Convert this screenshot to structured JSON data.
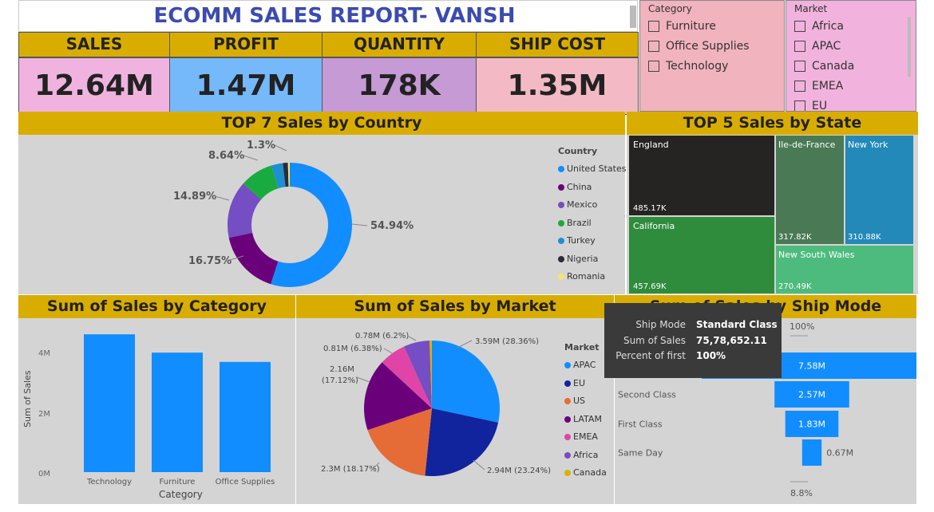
{
  "report": {
    "title": "ECOMM SALES REPORT- VANSH"
  },
  "kpis": [
    {
      "label": "SALES",
      "value": "12.64M",
      "bg": "#f0b3df"
    },
    {
      "label": "PROFIT",
      "value": "1.47M",
      "bg": "#75b9fa"
    },
    {
      "label": "QUANTITY",
      "value": "178K",
      "bg": "#c59ad5"
    },
    {
      "label": "SHIP COST",
      "value": "1.35M",
      "bg": "#f3b9c4"
    }
  ],
  "category_slicer": {
    "title": "Category",
    "items": [
      "Furniture",
      "Office Supplies",
      "Technology"
    ]
  },
  "market_slicer": {
    "title": "Market",
    "items": [
      "Africa",
      "APAC",
      "Canada",
      "EMEA",
      "EU"
    ]
  },
  "country_chart": {
    "title": "TOP 7 Sales by Country",
    "legend_title": "Country",
    "labels": {
      "us": "54.94%",
      "china": "16.75%",
      "mexico": "14.89%",
      "brazil": "8.64%",
      "turkey": "1.3%"
    }
  },
  "state_chart": {
    "title": "TOP 5 Sales by State",
    "cells": [
      {
        "name": "England",
        "value": "485.17K"
      },
      {
        "name": "California",
        "value": "457.69K"
      },
      {
        "name": "Ile-de-France",
        "value": "317.82K"
      },
      {
        "name": "New York",
        "value": "310.88K"
      },
      {
        "name": "New South Wales",
        "value": "270.49K"
      }
    ]
  },
  "category_chart": {
    "title": "Sum of Sales by Category",
    "xlabel": "Category",
    "ylabel": "Sum of Sales",
    "ticks": [
      "4M",
      "2M",
      "0M"
    ]
  },
  "market_chart": {
    "title": "Sum of Sales by Market",
    "legend_title": "Market",
    "labels": {
      "apac": "3.59M (28.36%)",
      "eu": "2.94M (23.24%)",
      "us": "2.3M (18.17%)",
      "latam_a": "2.16M",
      "latam_b": "(17.12%)",
      "emea": "0.81M (6.38%)",
      "africa": "0.78M (6.2%)"
    }
  },
  "ship_chart": {
    "title": "Sum of Sales by Ship Mode",
    "top_pct": "100%",
    "bottom_pct": "8.8%",
    "bars": [
      {
        "name": "Standard Class",
        "value": "7.58M"
      },
      {
        "name": "Second Class",
        "value": "2.57M"
      },
      {
        "name": "First Class",
        "value": "1.83M"
      },
      {
        "name": "Same Day",
        "value": "0.67M"
      }
    ]
  },
  "tooltip": {
    "rows": [
      {
        "k": "Ship Mode",
        "v": "Standard Class"
      },
      {
        "k": "Sum of Sales",
        "v": "75,78,652.11"
      },
      {
        "k": "Percent of first",
        "v": "100%"
      }
    ]
  },
  "chart_data": [
    {
      "type": "pie",
      "title": "TOP 7 Sales by Country",
      "legend_title": "Country",
      "categories": [
        "United States",
        "China",
        "Mexico",
        "Brazil",
        "Turkey",
        "Nigeria",
        "Romania"
      ],
      "values": [
        54.94,
        16.75,
        14.89,
        8.64,
        3.0,
        1.3,
        0.48
      ],
      "colors": [
        "#118dff",
        "#6b007b",
        "#744ec2",
        "#1aab40",
        "#1f8fd0",
        "#2b2b3b",
        "#f5e56b"
      ],
      "legend": "right"
    },
    {
      "type": "heatmap",
      "title": "TOP 5 Sales by State",
      "categories": [
        "England",
        "California",
        "Ile-de-France",
        "New York",
        "New South Wales"
      ],
      "values": [
        485.17,
        457.69,
        317.82,
        310.88,
        270.49
      ],
      "unit": "K"
    },
    {
      "type": "bar",
      "title": "Sum of Sales by Category",
      "categories": [
        "Technology",
        "Furniture",
        "Office Supplies"
      ],
      "values": [
        4.74,
        4.11,
        3.79
      ],
      "xlabel": "Category",
      "ylabel": "Sum of Sales",
      "ylim": [
        0,
        4.8
      ],
      "y_ticks": [
        0,
        2,
        4
      ],
      "unit": "M",
      "color": "#118dff"
    },
    {
      "type": "pie",
      "title": "Sum of Sales by Market",
      "legend_title": "Market",
      "categories": [
        "APAC",
        "EU",
        "US",
        "LATAM",
        "EMEA",
        "Africa",
        "Canada"
      ],
      "values": [
        3.59,
        2.94,
        2.3,
        2.16,
        0.81,
        0.78,
        0.07
      ],
      "colors": [
        "#118dff",
        "#12239e",
        "#e66c37",
        "#6b007b",
        "#e044a7",
        "#744ec2",
        "#d9b300"
      ],
      "legend": "right"
    },
    {
      "type": "bar",
      "title": "Sum of Sales by Ship Mode",
      "categories": [
        "Standard Class",
        "Second Class",
        "First Class",
        "Same Day"
      ],
      "values": [
        7.58,
        2.57,
        1.83,
        0.67
      ],
      "unit": "M",
      "color": "#118dff"
    }
  ]
}
